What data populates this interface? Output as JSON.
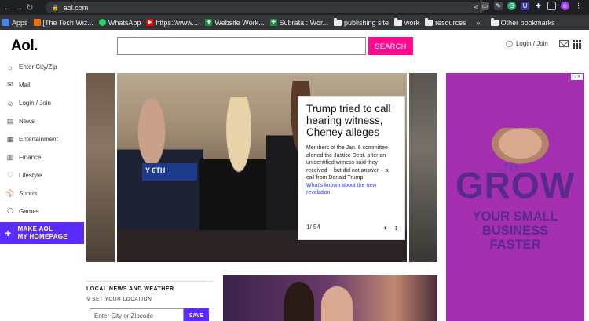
{
  "browser": {
    "url": "aol.com",
    "bookmarks": [
      {
        "label": "Apps",
        "kind": "apps"
      },
      {
        "label": "[The Tech Wiz...",
        "kind": "site"
      },
      {
        "label": "WhatsApp",
        "kind": "whatsapp"
      },
      {
        "label": "https://www....",
        "kind": "youtube"
      },
      {
        "label": "Website Work...",
        "kind": "green"
      },
      {
        "label": "Subrata:: Wor...",
        "kind": "green"
      },
      {
        "label": "publishing site",
        "kind": "folder"
      },
      {
        "label": "work",
        "kind": "folder"
      },
      {
        "label": "resources",
        "kind": "folder"
      }
    ],
    "more_bookmarks": "»",
    "other_bookmarks": "Other bookmarks"
  },
  "header": {
    "logo": "Aol.",
    "search_placeholder": "",
    "search_button": "SEARCH",
    "login": "Login / Join"
  },
  "sidebar": {
    "items": [
      {
        "label": "Enter City/Zip",
        "icon": "weather-icon"
      },
      {
        "label": "Mail",
        "icon": "mail-icon"
      },
      {
        "label": "Login / Join",
        "icon": "user-icon"
      },
      {
        "label": "News",
        "icon": "news-icon"
      },
      {
        "label": "Entertainment",
        "icon": "entertainment-icon"
      },
      {
        "label": "Finance",
        "icon": "finance-icon"
      },
      {
        "label": "Lifestyle",
        "icon": "heart-icon"
      },
      {
        "label": "Sports",
        "icon": "sports-icon"
      },
      {
        "label": "Games",
        "icon": "games-icon"
      }
    ],
    "make_aol_line1": "MAKE AOL",
    "make_aol_line2": "MY HOMEPAGE"
  },
  "hero": {
    "sign_text": "Y 6TH",
    "title": "Trump tried to call hearing witness, Cheney alleges",
    "body": "Members of the Jan. 6 committee alerted the Justice Dept. after an unidentified witness said they received -- but did not answer -- a call from Donald Trump.",
    "link": "What's known about the new revelation",
    "counter": "1/ 54"
  },
  "local": {
    "title": "LOCAL NEWS AND WEATHER",
    "set_location": "SET YOUR LOCATION",
    "input_placeholder": "Enter City or Zipcode",
    "save": "SAVE"
  },
  "ad": {
    "to": "TO",
    "grow": "GROW",
    "tagline_1": "YOUR SMALL",
    "tagline_2": "BUSINESS",
    "tagline_3": "FASTER"
  },
  "colors": {
    "brand_pink": "#ff0b8c",
    "brand_purple": "#5b2bff",
    "ad_background": "#a52fb1"
  }
}
